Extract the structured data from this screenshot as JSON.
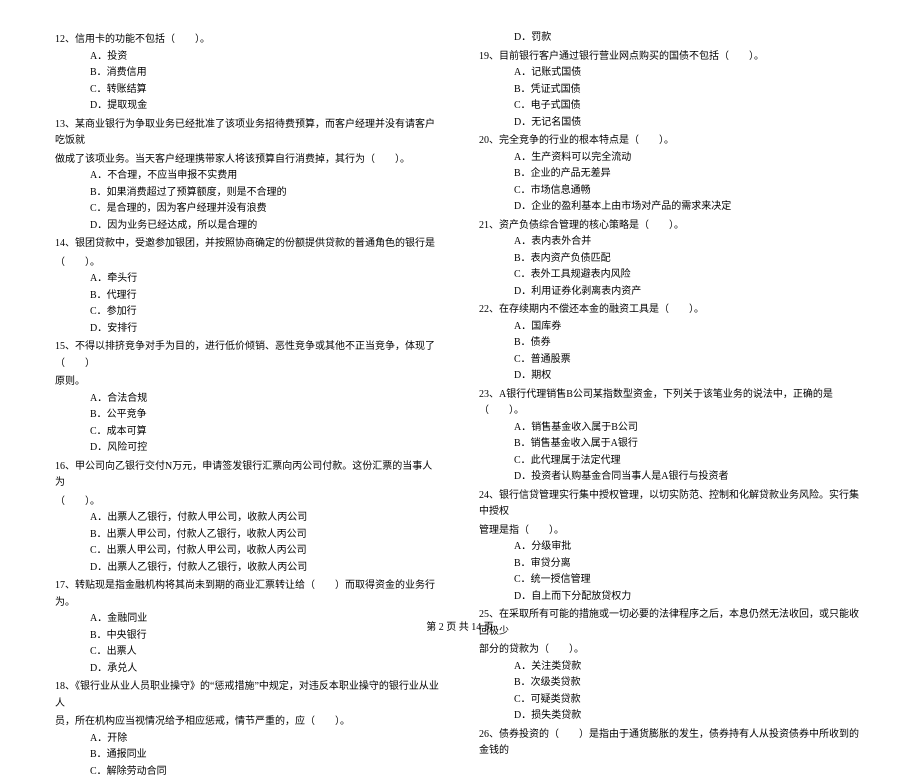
{
  "footer": "第 2 页 共 14 页",
  "left": [
    {
      "cls": "q-stem",
      "t": "12、信用卡的功能不包括（　　）。"
    },
    {
      "cls": "q-opt",
      "t": "A．投资"
    },
    {
      "cls": "q-opt",
      "t": "B．消费信用"
    },
    {
      "cls": "q-opt",
      "t": "C．转账结算"
    },
    {
      "cls": "q-opt",
      "t": "D．提取现金"
    },
    {
      "cls": "q-stem",
      "t": "13、某商业银行为争取业务已经批准了该项业务招待费预算，而客户经理并没有请客户吃饭就"
    },
    {
      "cls": "q-stem cont",
      "t": "做成了该项业务。当天客户经理携带家人将该预算自行消费掉，其行为（　　）。"
    },
    {
      "cls": "q-opt",
      "t": "A．不合理，不应当申报不实费用"
    },
    {
      "cls": "q-opt",
      "t": "B．如果消费超过了预算额度，则是不合理的"
    },
    {
      "cls": "q-opt",
      "t": "C．是合理的，因为客户经理并没有浪费"
    },
    {
      "cls": "q-opt",
      "t": "D．因为业务已经达成，所以是合理的"
    },
    {
      "cls": "q-stem",
      "t": "14、银团贷款中，受邀参加银团，并按照协商确定的份额提供贷款的普通角色的银行是"
    },
    {
      "cls": "q-stem cont",
      "t": "（　　）。"
    },
    {
      "cls": "q-opt",
      "t": "A．牵头行"
    },
    {
      "cls": "q-opt",
      "t": "B．代理行"
    },
    {
      "cls": "q-opt",
      "t": "C．参加行"
    },
    {
      "cls": "q-opt",
      "t": "D．安排行"
    },
    {
      "cls": "q-stem",
      "t": "15、不得以排挤竞争对手为目的，进行低价倾销、恶性竞争或其他不正当竞争，体现了（　　）"
    },
    {
      "cls": "q-stem cont",
      "t": "原则。"
    },
    {
      "cls": "q-opt",
      "t": "A．合法合规"
    },
    {
      "cls": "q-opt",
      "t": "B．公平竞争"
    },
    {
      "cls": "q-opt",
      "t": "C．成本可算"
    },
    {
      "cls": "q-opt",
      "t": "D．风险可控"
    },
    {
      "cls": "q-stem",
      "t": "16、甲公司向乙银行交付N万元，申请签发银行汇票向丙公司付款。这份汇票的当事人为"
    },
    {
      "cls": "q-stem cont",
      "t": "（　　）。"
    },
    {
      "cls": "q-opt",
      "t": "A．出票人乙银行，付款人甲公司，收款人丙公司"
    },
    {
      "cls": "q-opt",
      "t": "B．出票人甲公司，付款人乙银行，收款人丙公司"
    },
    {
      "cls": "q-opt",
      "t": "C．出票人甲公司，付款人甲公司，收款人丙公司"
    },
    {
      "cls": "q-opt",
      "t": "D．出票人乙银行，付款人乙银行，收款人丙公司"
    },
    {
      "cls": "q-stem",
      "t": "17、转贴现是指金融机构将其尚未到期的商业汇票转让给（　　）而取得资金的业务行为。"
    },
    {
      "cls": "q-opt",
      "t": "A．金融同业"
    },
    {
      "cls": "q-opt",
      "t": "B．中央银行"
    },
    {
      "cls": "q-opt",
      "t": "C．出票人"
    },
    {
      "cls": "q-opt",
      "t": "D．承兑人"
    },
    {
      "cls": "q-stem",
      "t": "18、《银行业从业人员职业操守》的“惩戒措施”中规定，对违反本职业操守的银行业从业人"
    },
    {
      "cls": "q-stem cont",
      "t": "员，所在机构应当视情况给予相应惩戒，情节严重的，应（　　）。"
    },
    {
      "cls": "q-opt",
      "t": "A．开除"
    },
    {
      "cls": "q-opt",
      "t": "B．通报同业"
    },
    {
      "cls": "q-opt",
      "t": "C．解除劳动合同"
    }
  ],
  "right": [
    {
      "cls": "q-opt",
      "t": "D．罚款"
    },
    {
      "cls": "q-stem",
      "t": "19、目前银行客户通过银行营业网点购买的国债不包括（　　）。"
    },
    {
      "cls": "q-opt",
      "t": "A．记账式国债"
    },
    {
      "cls": "q-opt",
      "t": "B．凭证式国债"
    },
    {
      "cls": "q-opt",
      "t": "C．电子式国债"
    },
    {
      "cls": "q-opt",
      "t": "D．无记名国债"
    },
    {
      "cls": "q-stem",
      "t": "20、完全竞争的行业的根本特点是（　　）。"
    },
    {
      "cls": "q-opt",
      "t": "A．生产资料可以完全流动"
    },
    {
      "cls": "q-opt",
      "t": "B．企业的产品无差异"
    },
    {
      "cls": "q-opt",
      "t": "C．市场信息通畅"
    },
    {
      "cls": "q-opt",
      "t": "D．企业的盈利基本上由市场对产品的需求来决定"
    },
    {
      "cls": "q-stem",
      "t": "21、资产负债综合管理的核心策略是（　　）。"
    },
    {
      "cls": "q-opt",
      "t": "A．表内表外合并"
    },
    {
      "cls": "q-opt",
      "t": "B．表内资产负债匹配"
    },
    {
      "cls": "q-opt",
      "t": "C．表外工具规避表内风险"
    },
    {
      "cls": "q-opt",
      "t": "D．利用证券化剥离表内资产"
    },
    {
      "cls": "q-stem",
      "t": "22、在存续期内不偿还本金的融资工具是（　　）。"
    },
    {
      "cls": "q-opt",
      "t": "A．国库券"
    },
    {
      "cls": "q-opt",
      "t": "B．债券"
    },
    {
      "cls": "q-opt",
      "t": "C．普通股票"
    },
    {
      "cls": "q-opt",
      "t": "D．期权"
    },
    {
      "cls": "q-stem",
      "t": "23、A银行代理销售B公司某指数型资金，下列关于该笔业务的说法中，正确的是（　　）。"
    },
    {
      "cls": "q-opt",
      "t": "A．销售基金收入属于B公司"
    },
    {
      "cls": "q-opt",
      "t": "B．销售基金收入属于A银行"
    },
    {
      "cls": "q-opt",
      "t": "C．此代理属于法定代理"
    },
    {
      "cls": "q-opt",
      "t": "D．投资者认购基金合同当事人是A银行与投资者"
    },
    {
      "cls": "q-stem",
      "t": "24、银行信贷管理实行集中授权管理，以切实防范、控制和化解贷款业务风险。实行集中授权"
    },
    {
      "cls": "q-stem cont",
      "t": "管理是指（　　）。"
    },
    {
      "cls": "q-opt",
      "t": "A．分级审批"
    },
    {
      "cls": "q-opt",
      "t": "B．审贷分离"
    },
    {
      "cls": "q-opt",
      "t": "C．统一授信管理"
    },
    {
      "cls": "q-opt",
      "t": "D．自上而下分配放贷权力"
    },
    {
      "cls": "q-stem",
      "t": "25、在采取所有可能的措施或一切必要的法律程序之后，本息仍然无法收回，或只能收回极少"
    },
    {
      "cls": "q-stem cont",
      "t": "部分的贷款为（　　）。"
    },
    {
      "cls": "q-opt",
      "t": "A．关注类贷款"
    },
    {
      "cls": "q-opt",
      "t": "B．次级类贷款"
    },
    {
      "cls": "q-opt",
      "t": "C．可疑类贷款"
    },
    {
      "cls": "q-opt",
      "t": "D．损失类贷款"
    },
    {
      "cls": "q-stem",
      "t": "26、债券投资的（　　）是指由于通货膨胀的发生，债券持有人从投资债券中所收到的金钱的"
    }
  ]
}
